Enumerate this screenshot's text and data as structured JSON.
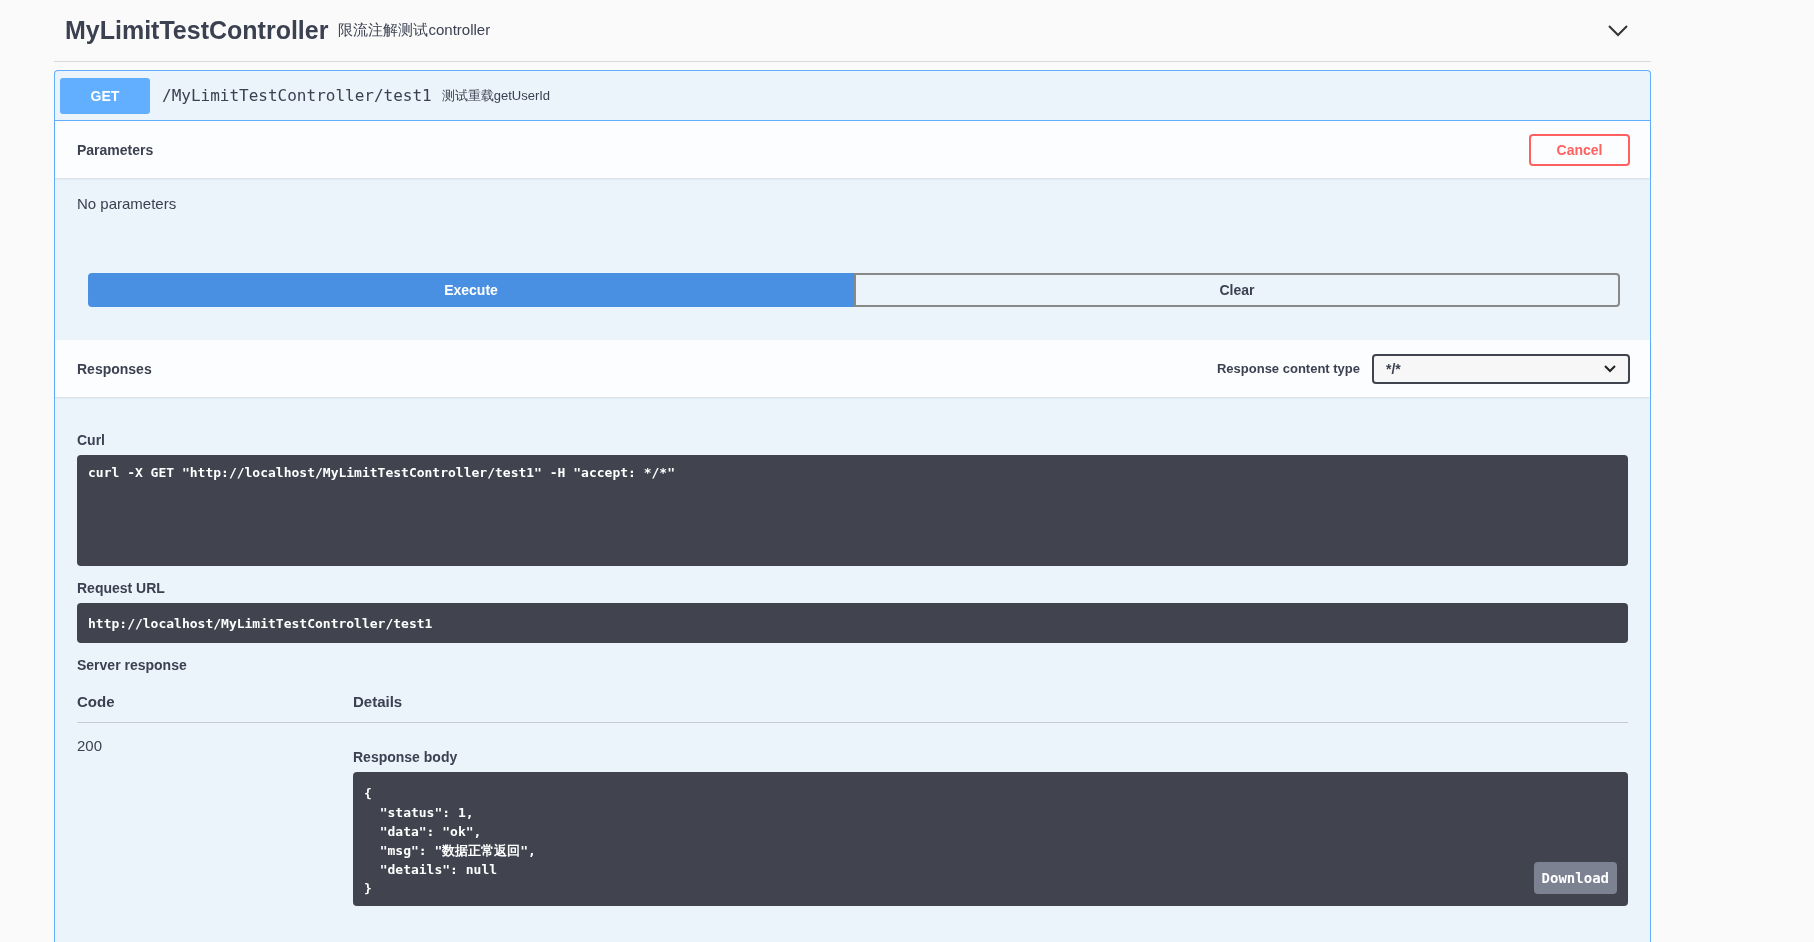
{
  "tag": {
    "name": "MyLimitTestController",
    "description": "限流注解测试controller",
    "expanded": true
  },
  "operation": {
    "method": "GET",
    "path": "/MyLimitTestController/test1",
    "summary": "测试重载getUserId",
    "parameters": {
      "title": "Parameters",
      "cancel_button": "Cancel",
      "empty_text": "No parameters"
    },
    "execute_button": "Execute",
    "clear_button": "Clear",
    "responses": {
      "title": "Responses",
      "content_type_label": "Response content type",
      "content_type": "*/*"
    },
    "curl": {
      "label": "Curl",
      "command": "curl -X GET \"http://localhost/MyLimitTestController/test1\" -H \"accept: */*\""
    },
    "request_url": {
      "label": "Request URL",
      "value": "http://localhost/MyLimitTestController/test1"
    },
    "server_response": {
      "title": "Server response",
      "columns": [
        "Code",
        "Details"
      ],
      "code": "200",
      "body_label": "Response body",
      "body": "{\n  \"status\": 1,\n  \"data\": \"ok\",\n  \"msg\": \"数据正常返回\",\n  \"details\": null\n}",
      "download_button": "Download"
    }
  }
}
